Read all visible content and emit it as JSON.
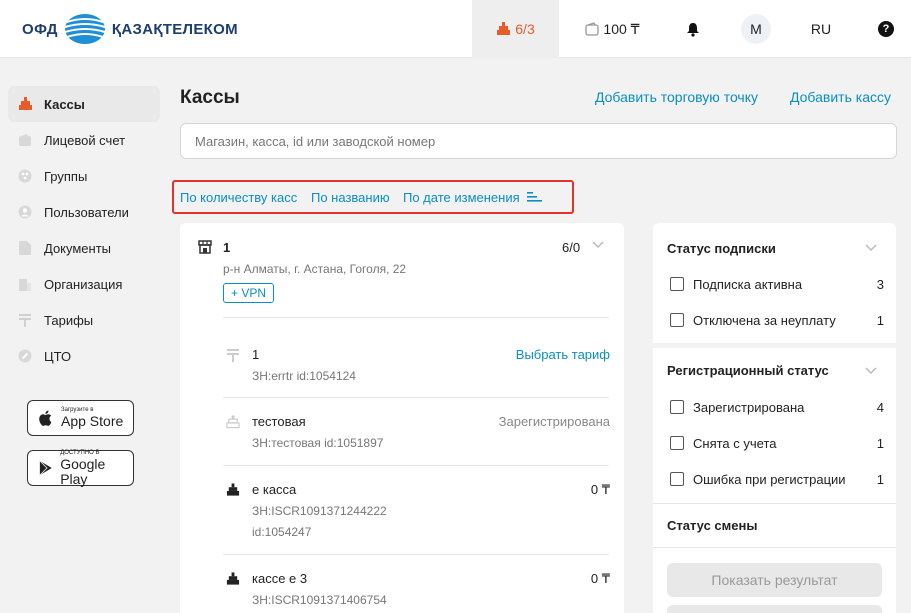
{
  "header": {
    "logo_left": "ОФД",
    "logo_right": "ҚАЗАҚТЕЛЕКОМ",
    "kassa_count": "6/3",
    "balance": "100 ₸",
    "avatar_letter": "M",
    "language": "RU",
    "help": "?"
  },
  "sidebar": {
    "items": [
      {
        "label": "Кассы",
        "icon": "cash-register-icon"
      },
      {
        "label": "Лицевой счет",
        "icon": "wallet-icon"
      },
      {
        "label": "Группы",
        "icon": "groups-icon"
      },
      {
        "label": "Пользователи",
        "icon": "user-icon"
      },
      {
        "label": "Документы",
        "icon": "document-icon"
      },
      {
        "label": "Организация",
        "icon": "building-icon"
      },
      {
        "label": "Тарифы",
        "icon": "tariff-icon"
      },
      {
        "label": "ЦТО",
        "icon": "cto-icon"
      }
    ],
    "appstore": {
      "small": "Загрузите в",
      "big": "App Store"
    },
    "googleplay": {
      "small": "ДОСТУПНО В",
      "big": "Google Play"
    }
  },
  "main": {
    "title": "Кассы",
    "add_shop": "Добавить торговую точку",
    "add_kassa": "Добавить кассу",
    "search_placeholder": "Магазин, касса, id или заводской номер",
    "sort": {
      "by_count": "По количеству касс",
      "by_name": "По названию",
      "by_date": "По дате изменения"
    },
    "shop": {
      "name": "1",
      "count": "6/0",
      "address": "р-н Алматы, г. Астана, Гоголя, 22",
      "vpn": "+ VPN"
    },
    "kassas": [
      {
        "name": "1",
        "sub1": "ЗН:errtr  id:1054124",
        "sub2": "",
        "right": "Выбрать тариф"
      },
      {
        "name": "тестовая",
        "sub1": "ЗН:тестовая  id:1051897",
        "sub2": "",
        "right": "Зарегистрирована"
      },
      {
        "name": "е касса",
        "sub1": "ЗН:ISCR1091371244222",
        "sub2": "id:1054247",
        "right": "0 ₸"
      },
      {
        "name": "кассе е 3",
        "sub1": "ЗН:ISCR1091371406754",
        "sub2": "",
        "right": "0 ₸"
      }
    ]
  },
  "filters": {
    "subscription": {
      "title": "Статус подписки",
      "options": [
        {
          "label": "Подписка активна",
          "count": "3"
        },
        {
          "label": "Отключена за неуплату",
          "count": "1"
        }
      ]
    },
    "registration": {
      "title": "Регистрационный статус",
      "options": [
        {
          "label": "Зарегистрирована",
          "count": "4"
        },
        {
          "label": "Снята с учета",
          "count": "1"
        },
        {
          "label": "Ошибка при регистрации",
          "count": "1"
        }
      ]
    },
    "shift": {
      "title": "Статус смены"
    },
    "show_button": "Показать результат"
  },
  "colors": {
    "accent": "#0a8ec4",
    "highlight": "#e2342e",
    "brand": "#1c3f6e",
    "kassa_orange": "#e85c2c"
  }
}
